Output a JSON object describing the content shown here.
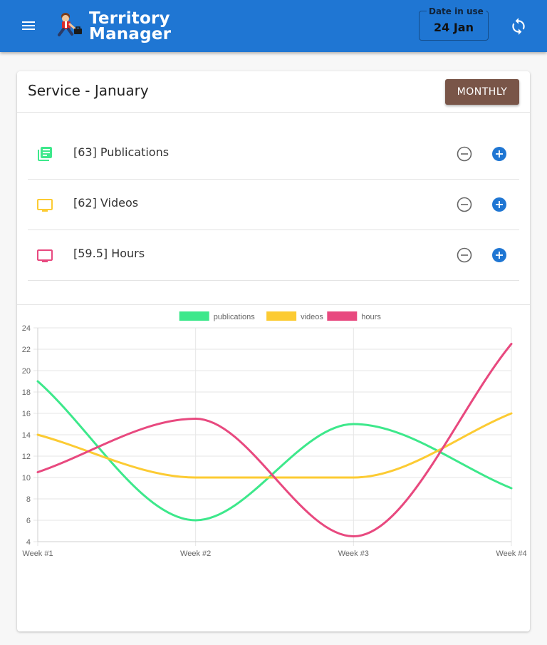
{
  "app": {
    "title_line1": "Territory",
    "title_line2": "Manager",
    "date_label": "Date in use",
    "date_value": "24 Jan",
    "brand_color": "#1f76d3"
  },
  "card": {
    "title": "Service - January",
    "period_button": "MONTHLY",
    "items": [
      {
        "label": "[63] Publications",
        "icon": "publications-icon",
        "color": "#3de88b"
      },
      {
        "label": "[62] Videos",
        "icon": "video-icon",
        "color": "#fccb33"
      },
      {
        "label": "[59.5] Hours",
        "icon": "hours-icon",
        "color": "#e8497f"
      }
    ]
  },
  "chart_data": {
    "type": "line",
    "categories": [
      "Week #1",
      "Week #2",
      "Week #3",
      "Week #4"
    ],
    "ylim": [
      4,
      24
    ],
    "yticks": [
      4,
      6,
      8,
      10,
      12,
      14,
      16,
      18,
      20,
      22,
      24
    ],
    "grid": true,
    "legend": "top",
    "series": [
      {
        "name": "publications",
        "color": "#3de88b",
        "values": [
          19,
          6,
          15,
          9
        ]
      },
      {
        "name": "videos",
        "color": "#fccb33",
        "values": [
          14,
          10,
          10,
          16
        ]
      },
      {
        "name": "hours",
        "color": "#e8497f",
        "values": [
          10.5,
          15.5,
          4.5,
          22.5
        ]
      }
    ]
  }
}
